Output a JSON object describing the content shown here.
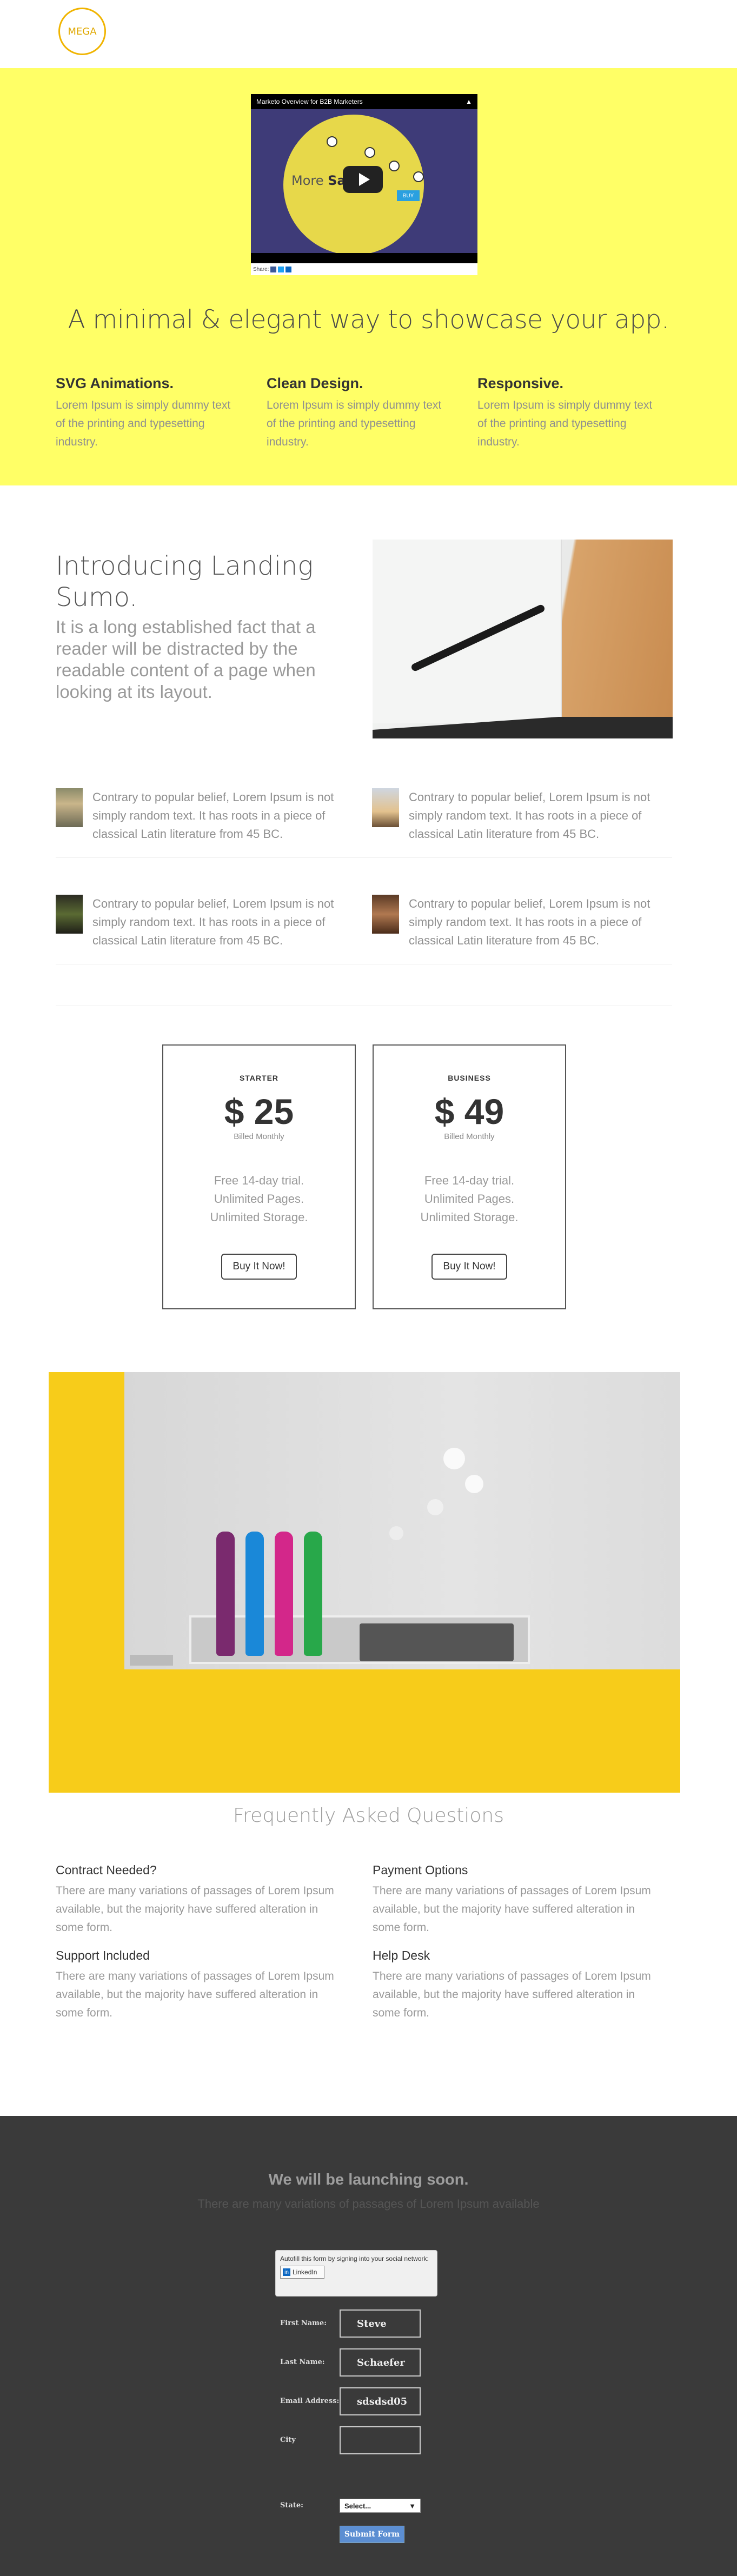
{
  "header": {
    "logo": "MEGA"
  },
  "video": {
    "title": "Marketo Overview for B2B Marketers",
    "slogan_part1": "More",
    "slogan_part2": "Savi",
    "chip": "BUY",
    "share_label": "Share:"
  },
  "hero": {
    "title": "A minimal & elegant way to showcase your app.",
    "features": [
      {
        "title": "SVG Animations.",
        "text": "Lorem Ipsum is simply dummy text of the printing and typesetting industry."
      },
      {
        "title": "Clean Design.",
        "text": "Lorem Ipsum is simply dummy text of the printing and typesetting industry."
      },
      {
        "title": "Responsive.",
        "text": "Lorem Ipsum is simply dummy text of the printing and typesetting industry."
      }
    ]
  },
  "intro": {
    "title": "Introducing Landing Sumo.",
    "lead": "It is a long established fact that a reader will be distracted by the readable content of a page when looking at its layout.",
    "items": [
      {
        "text": "Contrary to popular belief, Lorem Ipsum is not simply random text. It has roots in a piece of classical Latin literature from 45 BC."
      },
      {
        "text": "Contrary to popular belief, Lorem Ipsum is not simply random text. It has roots in a piece of classical Latin literature from 45 BC."
      },
      {
        "text": "Contrary to popular belief, Lorem Ipsum is not simply random text. It has roots in a piece of classical Latin literature from 45 BC."
      },
      {
        "text": "Contrary to popular belief, Lorem Ipsum is not simply random text. It has roots in a piece of classical Latin literature from 45 BC."
      }
    ]
  },
  "pricing": {
    "plans": [
      {
        "name": "STARTER",
        "price": "$ 25",
        "billed": "Billed Monthly",
        "perks": [
          "Free 14-day trial.",
          "Unlimited Pages.",
          "Unlimited Storage."
        ],
        "button": "Buy It Now!"
      },
      {
        "name": "BUSINESS",
        "price": "$ 49",
        "billed": "Billed Monthly",
        "perks": [
          "Free 14-day trial.",
          "Unlimited Pages.",
          "Unlimited Storage."
        ],
        "button": "Buy It Now!"
      }
    ]
  },
  "faq": {
    "title": "Frequently Asked Questions",
    "items": [
      {
        "q": "Contract Needed?",
        "a": "There are many variations of passages of Lorem Ipsum available, but the majority have suffered alteration in some form."
      },
      {
        "q": "Payment Options",
        "a": "There are many variations of passages of Lorem Ipsum available, but the majority have suffered alteration in some form."
      },
      {
        "q": "Support Included",
        "a": "There are many variations of passages of Lorem Ipsum available, but the majority have suffered alteration in some form."
      },
      {
        "q": "Help Desk",
        "a": "There are many variations of passages of Lorem Ipsum available, but the majority have suffered alteration in some form."
      }
    ]
  },
  "footer": {
    "title": "We will be launching soon.",
    "subtitle": "There are many variations of passages of Lorem Ipsum available",
    "social_text": "Autofill this form by signing into your social network:",
    "linkedin": "LinkedIn",
    "fields": [
      {
        "label": "First Name:",
        "value": "Steve"
      },
      {
        "label": "Last Name:",
        "value": "Schaefer"
      },
      {
        "label": "Email Address:",
        "value": "sdsdsd05"
      },
      {
        "label": "City",
        "value": ""
      }
    ],
    "state_label": "State:",
    "state_value": "Select...",
    "submit": "Submit Form"
  }
}
